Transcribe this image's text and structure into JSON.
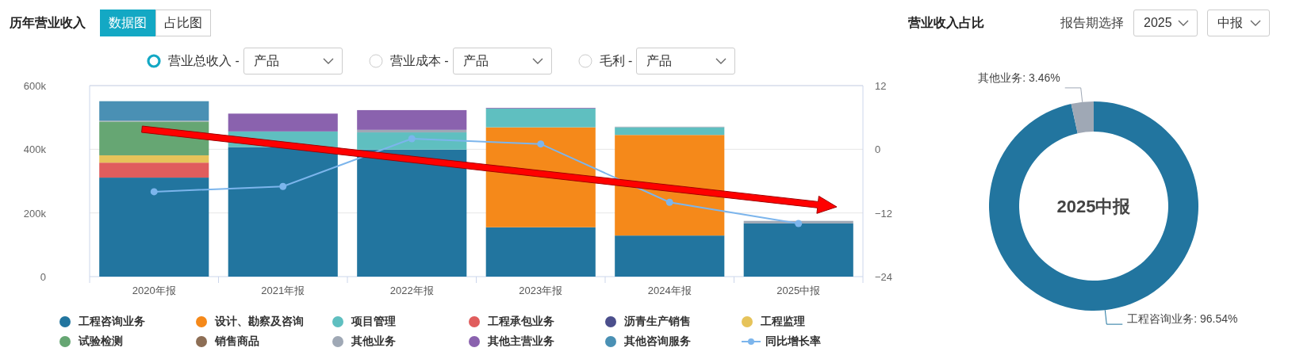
{
  "revenue_history": {
    "title": "历年营业收入",
    "view_tabs": [
      {
        "label": "数据图",
        "selected": true
      },
      {
        "label": "占比图",
        "selected": false
      }
    ],
    "metrics": [
      {
        "label": "营业总收入 -",
        "selected": true,
        "dropdown": "产品"
      },
      {
        "label": "营业成本 -",
        "selected": false,
        "dropdown": "产品"
      },
      {
        "label": "毛利 -",
        "selected": false,
        "dropdown": "产品"
      }
    ],
    "chart_data": {
      "type": "bar",
      "stacked": true,
      "categories": [
        "2020年报",
        "2021年报",
        "2022年报",
        "2023年报",
        "2024年报",
        "2025中报"
      ],
      "ylim": [
        0,
        600000
      ],
      "yticks": [
        0,
        {
          "value": 200000,
          "label": "200k"
        },
        {
          "value": 400000,
          "label": "400k"
        },
        {
          "value": 600000,
          "label": "600k"
        }
      ],
      "y2lim": [
        -24,
        12
      ],
      "y2ticks": [
        {
          "value": -24,
          "label": "−24"
        },
        {
          "value": -12,
          "label": "−12"
        },
        0,
        12
      ],
      "series": [
        {
          "name": "工程咨询业务",
          "color": "#22759f",
          "values": [
            311000,
            407000,
            399000,
            155000,
            129000,
            167000
          ]
        },
        {
          "name": "设计、勘察及咨询",
          "color": "#f5891a",
          "values": [
            null,
            null,
            null,
            314000,
            316000,
            null
          ]
        },
        {
          "name": "项目管理",
          "color": "#5fbfc0",
          "values": [
            null,
            49000,
            54000,
            59000,
            24000,
            null
          ]
        },
        {
          "name": "工程承包业务",
          "color": "#e05d5d",
          "values": [
            47000,
            null,
            null,
            null,
            null,
            null
          ]
        },
        {
          "name": "沥青生产销售",
          "color": "#4b4f8c",
          "values": [
            null,
            null,
            null,
            null,
            null,
            null
          ]
        },
        {
          "name": "工程监理",
          "color": "#e6c35a",
          "values": [
            23000,
            null,
            null,
            null,
            null,
            null
          ]
        },
        {
          "name": "试验检测",
          "color": "#66a673",
          "values": [
            106000,
            null,
            null,
            null,
            null,
            null
          ]
        },
        {
          "name": "销售商品",
          "color": "#8d6e55",
          "values": [
            null,
            null,
            null,
            null,
            null,
            null
          ]
        },
        {
          "name": "其他业务",
          "color": "#9fa8b5",
          "values": [
            3000,
            null,
            8000,
            null,
            2000,
            8000
          ]
        },
        {
          "name": "其他主营业务",
          "color": "#8a62ae",
          "values": [
            null,
            56000,
            62000,
            2000,
            null,
            null
          ]
        },
        {
          "name": "其他咨询服务",
          "color": "#4a90b4",
          "values": [
            61000,
            null,
            null,
            null,
            null,
            null
          ]
        },
        {
          "name": "同比增长率",
          "type": "line",
          "marker": true,
          "axis": "y2",
          "color": "#7cb5ec",
          "values": [
            -8,
            -7,
            2,
            1,
            -10,
            -14
          ]
        }
      ]
    },
    "annotation_arrow": {
      "color": "#ff0000"
    }
  },
  "revenue_share": {
    "title": "营业收入占比",
    "period_label": "报告期选择",
    "year_select": "2025",
    "period_select": "中报",
    "chart_data": {
      "type": "donut",
      "title": "2025中报",
      "values": [
        96.54,
        3.46
      ],
      "colors": [
        "#22759f",
        "#9fa8b5"
      ],
      "value_labels": [
        "工程咨询业务: 96.54%",
        "其他业务: 3.46%"
      ]
    }
  }
}
